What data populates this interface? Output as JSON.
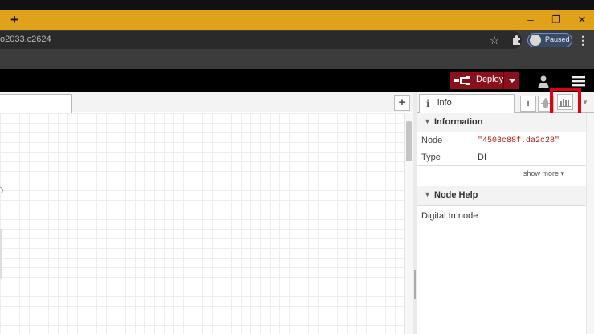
{
  "browser": {
    "new_tab_label": "+",
    "window_controls": {
      "minimize": "‒",
      "maximize": "❐",
      "close": "✕"
    },
    "address": {
      "url_text": "o2033.c2624"
    },
    "star_icon": "star-icon",
    "extensions_icon": "puzzle-icon",
    "profile": {
      "status": "Paused"
    },
    "menu_icon": "kebab-icon"
  },
  "nodered": {
    "deploy": {
      "label": "Deploy"
    },
    "workspace": {
      "add_flow_label": "+"
    },
    "sidebar": {
      "tab": {
        "icon_glyph": "i",
        "label": "info"
      },
      "buttons": {
        "info_glyph": "i"
      },
      "information": {
        "header": "Information",
        "rows": [
          {
            "key": "Node",
            "value": "\"4503c88f.da2c28\""
          },
          {
            "key": "Type",
            "value": "DI"
          }
        ],
        "show_more": "show more ▾"
      },
      "node_help": {
        "header": "Node Help",
        "text": "Digital In node"
      }
    }
  },
  "colors": {
    "chrome_frame": "#e0a21b",
    "deploy_red": "#8c101c",
    "highlight_box": "#e00010",
    "node_id_text": "#b71c1c"
  }
}
